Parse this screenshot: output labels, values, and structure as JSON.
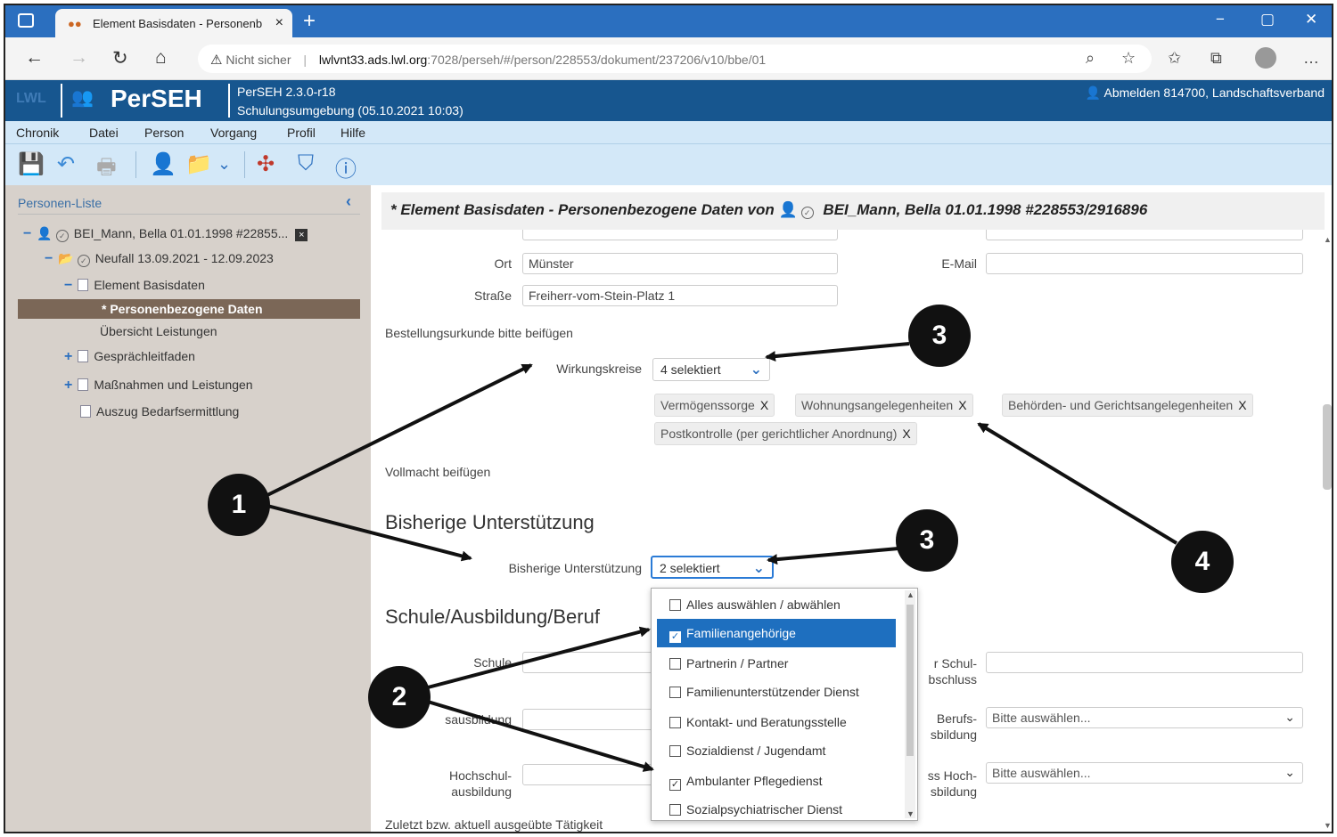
{
  "browser": {
    "tab_title": "Element Basisdaten - Personenb",
    "tab_close": "×",
    "new_tab": "+",
    "min": "−",
    "restore": "▢",
    "close": "✕",
    "insecure": "Nicht sicher",
    "url_host": "lwlvnt33.ads.lwl.org",
    "url_path": ":7028/perseh/#/person/228553/dokument/237206/v10/bbe/01"
  },
  "app": {
    "lwl": "LWL",
    "name": "PerSEH",
    "version": "PerSEH 2.3.0-r18",
    "environment": "Schulungsumgebung (05.10.2021 10:03)",
    "logout": "Abmelden 814700, Landschaftsverband"
  },
  "menu": [
    "Chronik",
    "Datei",
    "Person",
    "Vorgang",
    "Profil",
    "Hilfe"
  ],
  "sidebar": {
    "title": "Personen-Liste",
    "person": "BEI_Mann, Bella 01.01.1998 #22855...",
    "case": "Neufall 13.09.2021 - 12.09.2023",
    "element": "Element Basisdaten",
    "selected": "* Personenbezogene Daten",
    "overview": "Übersicht Leistungen",
    "guide": "Gesprächleitfaden",
    "measures": "Maßnahmen und Leistungen",
    "extract": "Auszug Bedarfsermittlung"
  },
  "main": {
    "header_prefix": "* Element Basisdaten - Personenbezogene Daten von",
    "header_person": "BEI_Mann, Bella 01.01.1998 #228553/2916896",
    "ort_label": "Ort",
    "ort_value": "Münster",
    "email_label": "E-Mail",
    "strasse_label": "Straße",
    "strasse_value": "Freiherr-vom-Stein-Platz 1",
    "bestellung": "Bestellungsurkunde bitte beifügen",
    "wirkungskreise_label": "Wirkungskreise",
    "wirkungskreise_value": "4 selektiert",
    "tags": [
      "Vermögenssorge",
      "Wohnungsangelegenheiten",
      "Behörden- und Gerichtsangelegenheiten",
      "Postkontrolle (per gerichtlicher Anordnung)"
    ],
    "tag_remove": "X",
    "vollmacht": "Vollmacht beifügen",
    "section_support": "Bisherige Unterstützung",
    "support_label": "Bisherige Unterstützung",
    "support_value": "2 selektiert",
    "section_school": "Schule/Ausbildung/Beruf",
    "schule_label": "Schule",
    "ausbildung_label": "sausbildung",
    "hochschul_label_1": "Hochschul-",
    "hochschul_label_2": "ausbildung",
    "r_schul_1": "r Schul-",
    "r_schul_2": "bschluss",
    "r_beruf_1": "Berufs-",
    "r_beruf_2": "sbildung",
    "r_hoch_1": "ss Hoch-",
    "r_hoch_2": "sbildung",
    "bitte": "Bitte auswählen...",
    "zuletzt": "Zuletzt bzw. aktuell ausgeübte Tätigkeit"
  },
  "dropdown": {
    "items": [
      {
        "label": "Alles auswählen / abwählen",
        "checked": false,
        "highlight": false
      },
      {
        "label": "Familienangehörige",
        "checked": true,
        "highlight": true
      },
      {
        "label": "Partnerin / Partner",
        "checked": false,
        "highlight": false
      },
      {
        "label": "Familienunterstützender Dienst",
        "checked": false,
        "highlight": false
      },
      {
        "label": "Kontakt- und Beratungsstelle",
        "checked": false,
        "highlight": false
      },
      {
        "label": "Sozialdienst / Jugendamt",
        "checked": false,
        "highlight": false
      },
      {
        "label": "Ambulanter Pflegedienst",
        "checked": true,
        "highlight": false
      },
      {
        "label": "Sozialpsychiatrischer Dienst",
        "checked": false,
        "highlight": false
      }
    ]
  },
  "annotations": [
    "1",
    "2",
    "3",
    "3",
    "4"
  ],
  "colors": {
    "header": "#17568f",
    "menu": "#d3e8f8",
    "sidebar": "#d7d1cb",
    "selected": "#7b6757",
    "highlight": "#1e6fbf"
  }
}
